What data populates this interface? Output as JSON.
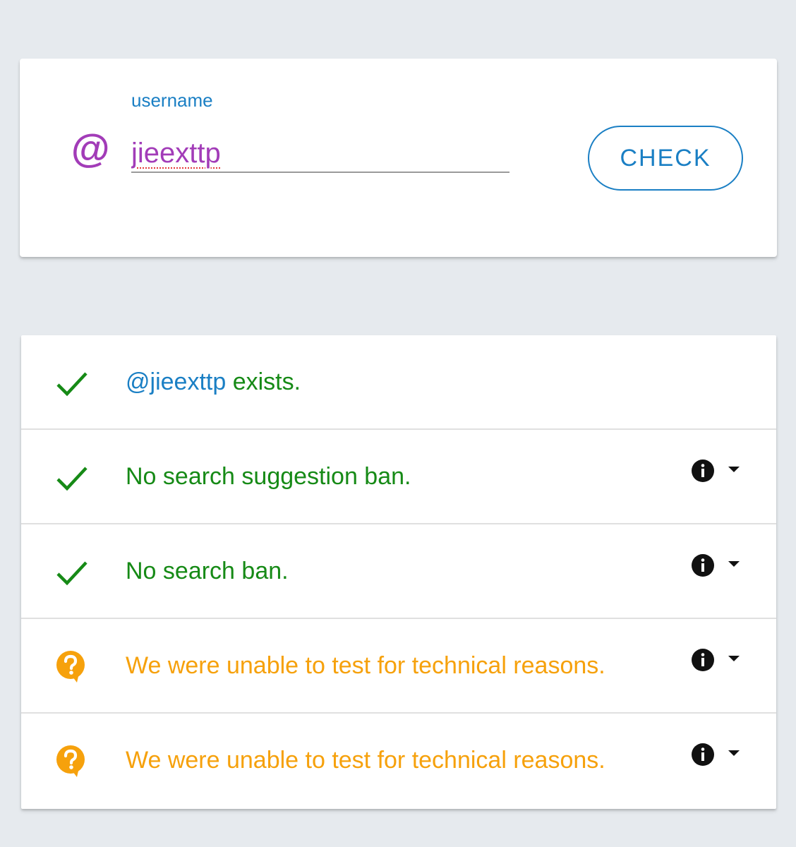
{
  "form": {
    "label": "username",
    "at_symbol": "@",
    "value": "jieexttp",
    "check_label": "CHECK"
  },
  "results": [
    {
      "status": "ok",
      "mention": "@jieexttp",
      "text": " exists.",
      "has_info": false
    },
    {
      "status": "ok",
      "text": "No search suggestion ban.",
      "has_info": true
    },
    {
      "status": "ok",
      "text": "No search ban.",
      "has_info": true
    },
    {
      "status": "warn",
      "text": "We were unable to test for technical reasons.",
      "has_info": true
    },
    {
      "status": "warn",
      "text": "We were unable to test for technical reasons.",
      "has_info": true
    }
  ],
  "colors": {
    "ok": "#168a16",
    "warn": "#f6a10c",
    "accent": "#1a7fc4",
    "input": "#a23cb8"
  }
}
